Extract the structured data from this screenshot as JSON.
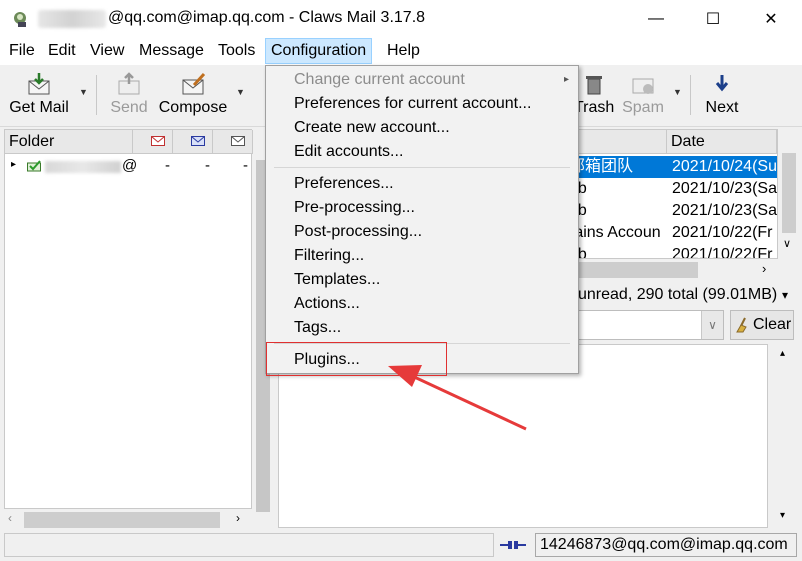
{
  "window": {
    "title": "@qq.com@imap.qq.com - Claws Mail 3.17.8",
    "minimize": "—",
    "maximize": "☐",
    "close": "✕"
  },
  "menubar": {
    "items": [
      "File",
      "Edit",
      "View",
      "Message",
      "Tools",
      "Configuration",
      "Help"
    ],
    "active": "Configuration"
  },
  "toolbar": {
    "get_mail": "Get Mail",
    "send": "Send",
    "compose": "Compose",
    "trash": "Trash",
    "spam": "Spam",
    "next": "Next"
  },
  "folder_pane": {
    "header": "Folder",
    "account_row": {
      "suffix": "@",
      "counts": [
        "-",
        "-",
        "-"
      ]
    }
  },
  "message_list": {
    "headers": {
      "from": "m",
      "date": "Date"
    },
    "rows": [
      {
        "from": "邮箱团队",
        "date": "2021/10/24(Su",
        "selected": true
      },
      {
        "from": "ub",
        "date": "2021/10/23(Sa",
        "selected": false
      },
      {
        "from": "ub",
        "date": "2021/10/23(Sa",
        "selected": false
      },
      {
        "from": "rains Accoun",
        "date": "2021/10/22(Fr",
        "selected": false
      },
      {
        "from": "ub",
        "date": "2021/10/22(Fr",
        "selected": false
      }
    ]
  },
  "summary": "unread, 290 total (99.01MB)",
  "quicksearch": {
    "clear_label": "Clear"
  },
  "status": {
    "account": "14246873@qq.com@imap.qq.com"
  },
  "config_menu": {
    "items": [
      {
        "label": "Change current account",
        "disabled": true,
        "submenu": true
      },
      {
        "label": "Preferences for current account...",
        "disabled": false
      },
      {
        "label": "Create new account...",
        "disabled": false
      },
      {
        "label": "Edit accounts...",
        "disabled": false
      },
      {
        "label": "Preferences...",
        "disabled": false
      },
      {
        "label": "Pre-processing...",
        "disabled": false
      },
      {
        "label": "Post-processing...",
        "disabled": false
      },
      {
        "label": "Filtering...",
        "disabled": false
      },
      {
        "label": "Templates...",
        "disabled": false
      },
      {
        "label": "Actions...",
        "disabled": false
      },
      {
        "label": "Tags...",
        "disabled": false
      },
      {
        "label": "Plugins...",
        "disabled": false
      }
    ]
  },
  "colors": {
    "selection": "#0078d7",
    "menu_highlight": "#cce8ff",
    "annotation": "#e03030"
  }
}
